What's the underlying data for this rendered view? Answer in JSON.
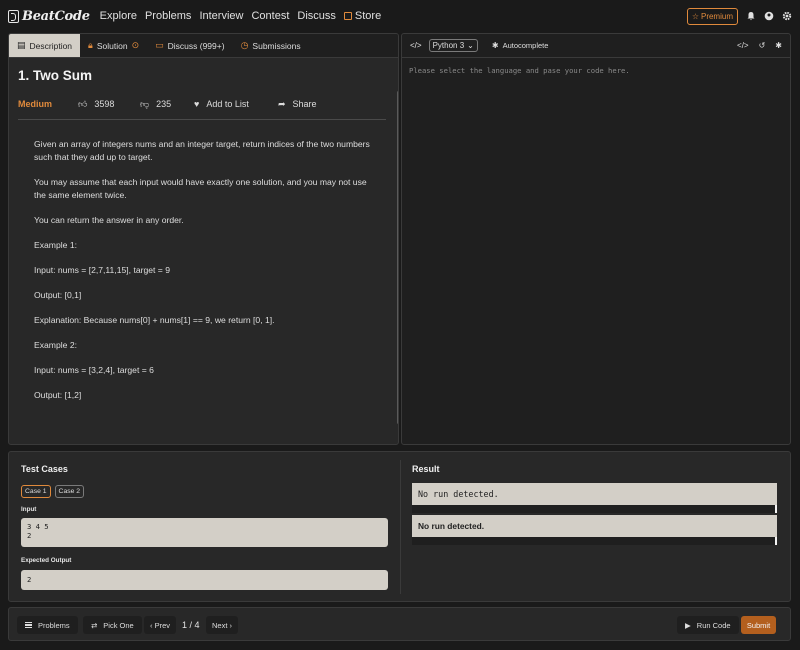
{
  "nav": {
    "brand": "BeatCode",
    "links": [
      "Explore",
      "Problems",
      "Interview",
      "Contest",
      "Discuss"
    ],
    "store": "Store",
    "premium": "Premium",
    "icons": [
      "bell-icon",
      "user-icon",
      "settings-icon"
    ]
  },
  "tabs": [
    {
      "label": "Description",
      "icon": "document-icon",
      "active": true
    },
    {
      "label": "Solution",
      "icon": "lock-icon",
      "active": false
    },
    {
      "label": "Discuss (999+)",
      "icon": "chat-icon",
      "active": false
    },
    {
      "label": "Submissions",
      "icon": "history-icon",
      "active": false
    }
  ],
  "problem": {
    "title": "1. Two Sum",
    "difficulty": "Medium",
    "likes": "3598",
    "dislikes": "235",
    "add_to_list": "Add to List",
    "share": "Share",
    "description": [
      "Given an array of integers nums and an integer target, return indices of the two numbers such that they add up to target.",
      "You may assume that each input would have exactly one solution, and you may not use the same element twice.",
      "You can return the answer in any order.",
      "Example 1:",
      "Input: nums = [2,7,11,15], target = 9",
      "Output: [0,1]",
      "Explanation: Because nums[0] + nums[1] == 9, we return [0, 1].",
      "Example 2:",
      "Input: nums = [3,2,4], target = 6",
      "Output: [1,2]"
    ]
  },
  "editor": {
    "language": "Python 3",
    "autocomplete": "Autocomplete",
    "placeholder": "Please select the language and pase your code here."
  },
  "testcases": {
    "title": "Test Cases",
    "cases": [
      "Case 1",
      "Case 2"
    ],
    "input_label": "Input",
    "input_value": "3 4 5\n2",
    "expected_label": "Expected Output",
    "expected_value": "2"
  },
  "result": {
    "title": "Result",
    "line1": "No run detected.",
    "line2": "No run detected."
  },
  "footer": {
    "problems": "Problems",
    "pick_one": "Pick One",
    "prev": "‹ Prev",
    "page": "1 / 4",
    "next": "Next ›",
    "run_code": "Run Code",
    "submit": "Submit"
  },
  "colors": {
    "accent": "#e08a3c",
    "submit": "#b35f1e",
    "panel": "#282828",
    "background": "#1a1a1a",
    "field": "#d3cfc7"
  }
}
